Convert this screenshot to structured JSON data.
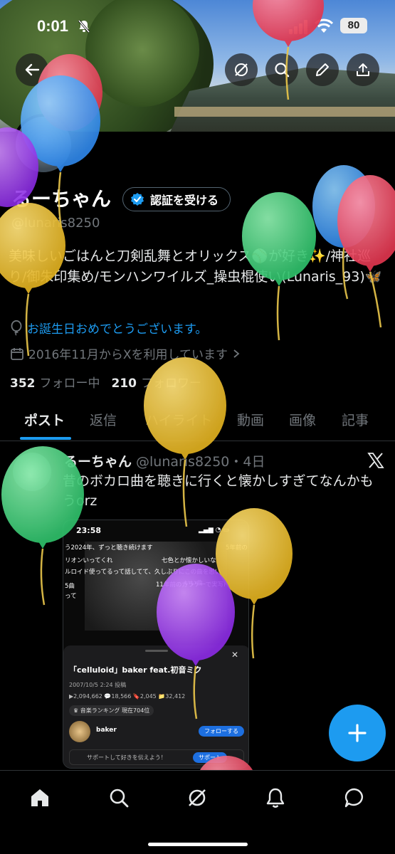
{
  "status_bar": {
    "time": "0:01",
    "battery": "80"
  },
  "profile": {
    "name": "るーちゃん",
    "verify_label": "認証を受ける",
    "handle": "@lunaris8250",
    "bio": "美味しいごはんと刀剣乱舞とオリックス⚾️が好き✨/神社巡り/御朱印集め/モンハンワイルズ_操虫棍使い(Lunaris_93)🦋",
    "birthday": "お誕生日おめでとうございます。",
    "joined": "2016年11月からXを利用しています",
    "following_count": "352",
    "following_label": "フォロー中",
    "followers_count": "210",
    "followers_label": "フォロワー"
  },
  "tabs": [
    {
      "label": "ポスト"
    },
    {
      "label": "返信"
    },
    {
      "label": "ハイライト"
    },
    {
      "label": "動画"
    },
    {
      "label": "画像"
    },
    {
      "label": "記事"
    }
  ],
  "post": {
    "author": "るーちゃん",
    "handle_time": "@lunaris8250・4日",
    "text": "昔のボカロ曲を聴きに行くと懐かしすぎてなんかもうorz",
    "embed": {
      "time": "23:58",
      "lines": [
        "う2024年、ずっと聴き続けます",
        "リオンいってくれ",
        "ルロイド使ってるって話してて、久しぶりにこの曲を思い",
        "5曲",
        "って",
        "七色とか懐かしいな",
        "いい曲",
        "11年前のガラケーで実写P",
        "5年前の"
      ],
      "title": "「celluloid」baker feat.初音ミク",
      "date": "2007/10/5 2:24 投稿",
      "stats": "▶2,094,662  💬18,566  🔖2,045  📁32,412",
      "rank": "♛ 音楽ランキング 現在704位",
      "channel": "baker",
      "follow": "フォローする",
      "support": "サポートして好きを伝えよう！",
      "support_btn": "サポート"
    }
  },
  "colors": {
    "accent": "#1d9bf0",
    "background": "#000000",
    "text": "#e7e9ea",
    "muted": "#71767b"
  },
  "icons": [
    "back-arrow-icon",
    "grok-icon",
    "search-icon",
    "edit-icon",
    "share-icon",
    "verified-badge-icon",
    "balloon-birthday-icon",
    "calendar-icon",
    "chevron-right-icon",
    "x-logo-icon",
    "plus-icon",
    "home-icon",
    "explore-icon",
    "grok-nav-icon",
    "notifications-icon",
    "messages-icon"
  ]
}
